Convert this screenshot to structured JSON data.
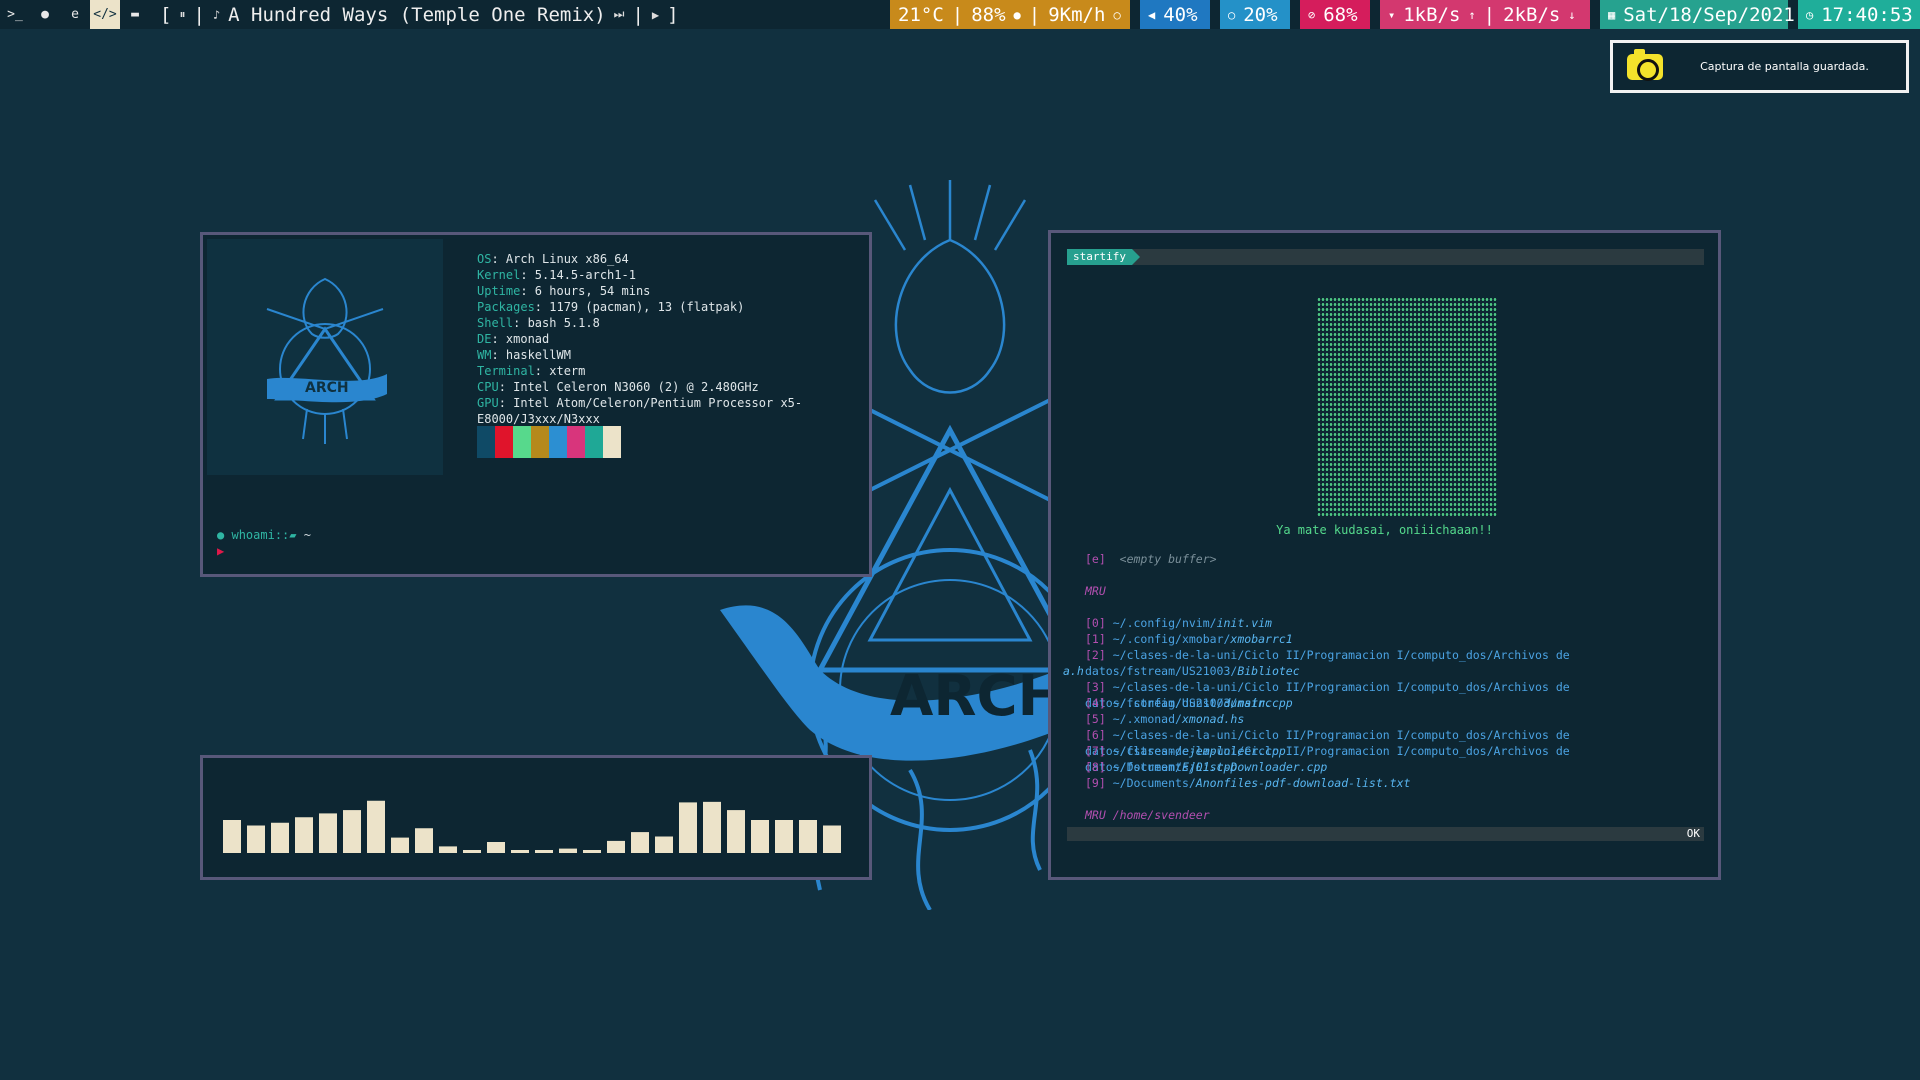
{
  "bar": {
    "workspaces": [
      {
        "icon": "terminal-icon",
        "glyph": ">_"
      },
      {
        "icon": "firefox-icon",
        "glyph": "●"
      },
      {
        "icon": "edge-icon",
        "glyph": "e"
      },
      {
        "icon": "code-icon",
        "glyph": "</>"
      },
      {
        "icon": "folder-icon",
        "glyph": "▬"
      }
    ],
    "song_open": "[",
    "song": "A Hundred Ways (Temple One Remix)",
    "song_close": "]",
    "weather": "21°C",
    "humidity": "88%",
    "wind": "9Km/h",
    "volume": "40%",
    "brightness": "20%",
    "battery": "68%",
    "net_up": "1kB/s",
    "net_down": "2kB/s",
    "date": "Sat/18/Sep/2021",
    "time": "17:40:53",
    "colors": {
      "weather": "#c88a1b",
      "volume": "#1f78c1",
      "brightness": "#2491c8",
      "battery": "#d51d5c",
      "net": "#d3386f",
      "date": "#26a28f",
      "time": "#1fae9a"
    }
  },
  "notification": {
    "text": "Captura de pantalla guardada."
  },
  "neofetch": {
    "info": [
      [
        "OS",
        ": Arch Linux x86_64"
      ],
      [
        "Kernel",
        ": 5.14.5-arch1-1"
      ],
      [
        "Uptime",
        ": 6 hours, 54 mins"
      ],
      [
        "Packages",
        ": 1179 (pacman), 13 (flatpak)"
      ],
      [
        "Shell",
        ": bash 5.1.8"
      ],
      [
        "DE",
        ": xmonad"
      ],
      [
        "WM",
        ": haskellWM"
      ],
      [
        "Terminal",
        ": xterm"
      ],
      [
        "CPU",
        ": Intel Celeron N3060 (2) @ 2.480GHz"
      ],
      [
        "GPU",
        ": Intel Atom/Celeron/Pentium Processor x5-E8000/J3xxx/N3xxx"
      ]
    ],
    "palette": [
      "#0f4a66",
      "#e0142b",
      "#57d98c",
      "#b5891c",
      "#2c8fd2",
      "#d8357c",
      "#1fa896",
      "#ece3c9"
    ],
    "prompt": "whoami::",
    "prompt_path": "~",
    "logo_text": "ARCH"
  },
  "visualizer": {
    "levels": [
      0.6,
      0.5,
      0.55,
      0.65,
      0.72,
      0.78,
      0.95,
      0.28,
      0.45,
      0.12,
      0.04,
      0.2,
      0.04,
      0.04,
      0.08,
      0.04,
      0.22,
      0.38,
      0.3,
      0.92,
      0.93,
      0.78,
      0.6,
      0.6,
      0.6,
      0.5
    ]
  },
  "nvim": {
    "tab": "startify",
    "greeting": "Ya mate kudasai, oniiichaaan!!",
    "empty_index": "[e]",
    "empty_label": "<empty buffer>",
    "mru_header": "MRU",
    "mru": [
      {
        "n": "[0]",
        "p": "~/.config/nvim/",
        "f": "init.vim"
      },
      {
        "n": "[1]",
        "p": "~/.config/xmobar/",
        "f": "xmobarrc1"
      },
      {
        "n": "[2]",
        "p": "~/clases-de-la-uni/Ciclo II/Programacion I/computo_dos/Archivos de datos/fstream/US21003/",
        "f": "Bibliotec"
      },
      {
        "n": "",
        "p": "",
        "f": "a.h"
      },
      {
        "n": "[3]",
        "p": "~/clases-de-la-uni/Ciclo II/Programacion I/computo_dos/Archivos de datos/fstream/US21003/",
        "f": "main.cpp"
      },
      {
        "n": "[4]",
        "p": "~/.config/dunst/",
        "f": "dunstrc"
      },
      {
        "n": "[5]",
        "p": "~/.xmonad/",
        "f": "xmonad.hs"
      },
      {
        "n": "[6]",
        "p": "~/clases-de-la-uni/Ciclo II/Programacion I/computo_dos/Archivos de datos/fstream/",
        "f": "ejemploleer.cpp"
      },
      {
        "n": "[7]",
        "p": "~/clases-de-la-uni/Ciclo II/Programacion I/computo_dos/Archivos de datos/fstream/",
        "f": "Ej01.cpp"
      },
      {
        "n": "[8]",
        "p": "~/Documents/",
        "f": "List-Downloader.cpp"
      },
      {
        "n": "[9]",
        "p": "~/Documents/",
        "f": "Anonfiles-pdf-download-list.txt"
      }
    ],
    "mru_dir": "MRU /home/svendeer",
    "status_ok": "OK"
  }
}
